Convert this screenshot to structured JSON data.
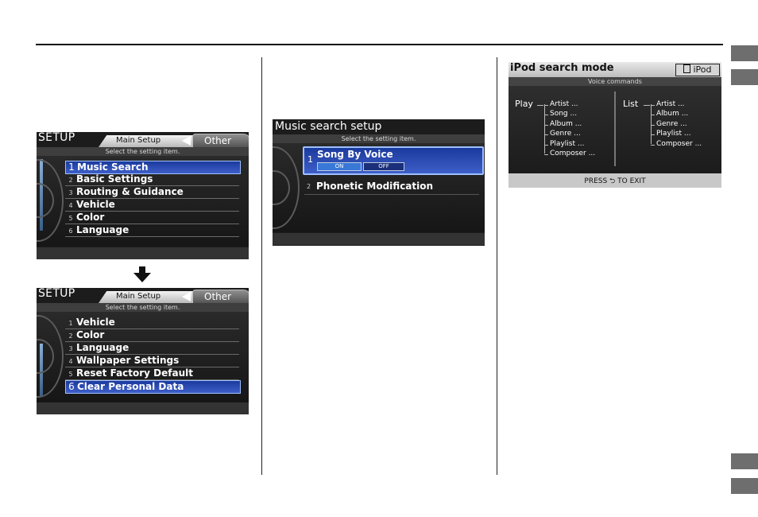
{
  "setup_screen_1": {
    "title": "SETUP",
    "tab_main": "Main Setup",
    "tab_other": "Other",
    "hint": "Select the setting item.",
    "items": [
      {
        "num": "1",
        "label": "Music Search"
      },
      {
        "num": "2",
        "label": "Basic Settings"
      },
      {
        "num": "3",
        "label": "Routing & Guidance"
      },
      {
        "num": "4",
        "label": "Vehicle"
      },
      {
        "num": "5",
        "label": "Color"
      },
      {
        "num": "6",
        "label": "Language"
      }
    ],
    "selected_index": 0
  },
  "setup_screen_2": {
    "title": "SETUP",
    "tab_main": "Main Setup",
    "tab_other": "Other",
    "hint": "Select the setting item.",
    "items": [
      {
        "num": "1",
        "label": "Vehicle"
      },
      {
        "num": "2",
        "label": "Color"
      },
      {
        "num": "3",
        "label": "Language"
      },
      {
        "num": "4",
        "label": "Wallpaper Settings"
      },
      {
        "num": "5",
        "label": "Reset Factory Default"
      },
      {
        "num": "6",
        "label": "Clear Personal Data"
      }
    ],
    "selected_index": 5
  },
  "music_search_screen": {
    "title": "Music search setup",
    "hint": "Select the setting item.",
    "item1_num": "1",
    "item1_label": "Song By Voice",
    "on_label": "ON",
    "off_label": "OFF",
    "item2_num": "2",
    "item2_label": "Phonetic Modification"
  },
  "ipod_screen": {
    "title": "iPod search mode",
    "badge": "iPod",
    "subtitle": "Voice commands",
    "play_label": "Play",
    "play_items": [
      "Artist ...",
      "Song ...",
      "Album ...",
      "Genre ...",
      "Playlist ...",
      "Composer ..."
    ],
    "list_label": "List",
    "list_items": [
      "Artist ...",
      "Album ...",
      "Genre ...",
      "Playlist ...",
      "Composer ..."
    ],
    "exit_text": "PRESS ⮌ TO EXIT"
  }
}
